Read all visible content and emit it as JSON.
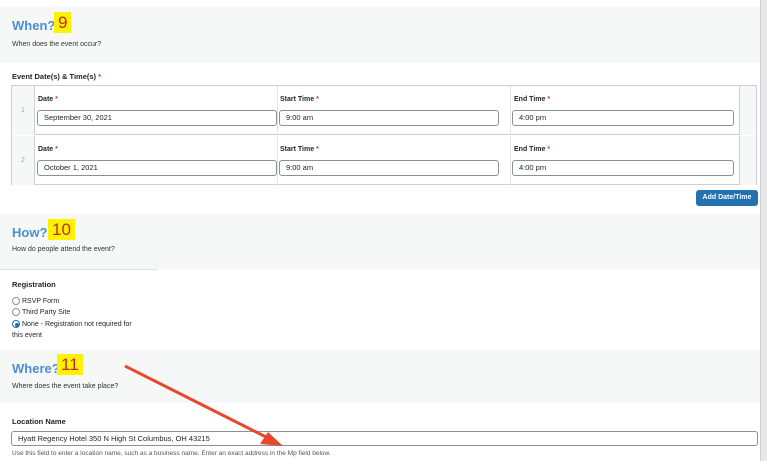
{
  "when": {
    "title": "When?",
    "badge": "9",
    "description": "When does the event occur?",
    "dates_label": "Event Date(s) & Time(s)",
    "required_mark": "*",
    "rows": [
      {
        "num": "1",
        "date_label": "Date",
        "date_value": "September 30, 2021",
        "start_label": "Start Time",
        "start_value": "9:00 am",
        "end_label": "End Time",
        "end_value": "4:00 pm"
      },
      {
        "num": "2",
        "date_label": "Date",
        "date_value": "October 1, 2021",
        "start_label": "Start Time",
        "start_value": "9:00 am",
        "end_label": "End Time",
        "end_value": "4:00 pm"
      }
    ],
    "add_button": "Add Date/Time"
  },
  "how": {
    "title": "How?",
    "badge": "10",
    "description": "How do people attend the event?",
    "registration_label": "Registration",
    "options": [
      {
        "label": "RSVP Form",
        "selected": false
      },
      {
        "label": "Third Party Site",
        "selected": false
      },
      {
        "label": "None - Registration not required for",
        "selected": true
      }
    ],
    "option_continuation": "this event"
  },
  "where": {
    "title": "Where?",
    "badge": "11",
    "description": "Where does the event take place?",
    "location_label": "Location Name",
    "location_value": "Hyatt Regency Hotel 350 N High St Columbus, OH 43215",
    "help_text": "Use this field to enter a location name, such as a business name. Enter an exact address in the Mp field below."
  },
  "colors": {
    "accent_title": "#4b8ed1",
    "badge_bg": "#fff200",
    "badge_text": "#c62828",
    "button": "#2271b1",
    "arrow": "#e8472b"
  }
}
